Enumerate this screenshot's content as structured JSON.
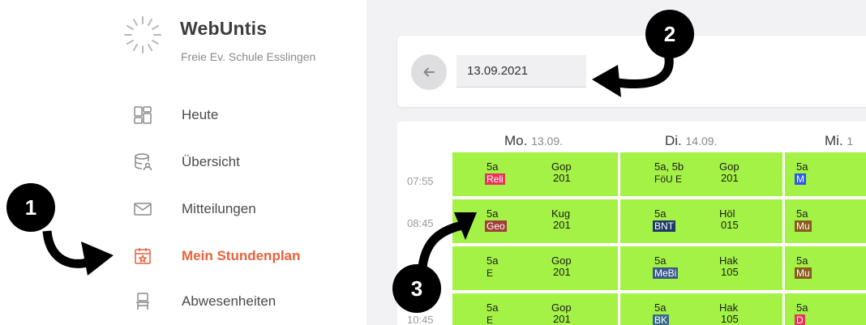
{
  "sidebar": {
    "brand_name": "WebUntis",
    "school": "Freie Ev. Schule Esslingen",
    "items": [
      {
        "label": "Heute",
        "icon": "dashboard-icon",
        "active": false
      },
      {
        "label": "Übersicht",
        "icon": "database-user-icon",
        "active": false
      },
      {
        "label": "Mitteilungen",
        "icon": "mail-icon",
        "active": false
      },
      {
        "label": "Mein Stundenplan",
        "icon": "calendar-star-icon",
        "active": true
      },
      {
        "label": "Abwesenheiten",
        "icon": "chair-icon",
        "active": false
      }
    ],
    "active_color": "#e8623c"
  },
  "date_bar": {
    "date_value": "13.09.2021",
    "back_icon": "arrow-left-icon"
  },
  "timetable": {
    "days": [
      {
        "name": "Mo.",
        "date": "13.09."
      },
      {
        "name": "Di.",
        "date": "14.09."
      },
      {
        "name": "Mi.",
        "date": "1"
      }
    ],
    "times": [
      "07:55",
      "08:45",
      "10:45"
    ],
    "lesson_color": "#a4f246",
    "rows": [
      {
        "mo": [
          {
            "class": "5a",
            "subject": "Reli",
            "subject_color": "#e8345a",
            "teacher": "Gop",
            "room": "201"
          }
        ],
        "di": [
          {
            "class": "5a, 5b",
            "subject": "FöU E",
            "subject_color": "",
            "teacher": "Gop",
            "room": "201"
          }
        ],
        "mi": [
          {
            "class": "5a",
            "subject": "M",
            "subject_color": "#2b5ce8",
            "teacher": "",
            "room": ""
          }
        ]
      },
      {
        "mo": [
          {
            "class": "5a",
            "subject": "Geo",
            "subject_color": "#a0403a",
            "teacher": "Kug",
            "room": "201"
          }
        ],
        "di": [
          {
            "class": "5a",
            "subject": "BNT",
            "subject_color": "#1e3a66",
            "teacher": "Höl",
            "room": "015"
          }
        ],
        "mi": [
          {
            "class": "5a",
            "subject": "Mu",
            "subject_color": "#8a5a1e",
            "teacher": "",
            "room": ""
          }
        ]
      },
      {
        "mo": [
          {
            "class": "5a",
            "subject": "E",
            "subject_color": "",
            "teacher": "Gop",
            "room": "201"
          }
        ],
        "di": [
          {
            "class": "5a",
            "subject": "MeBi",
            "subject_color": "#3a5a8a",
            "teacher": "Hak",
            "room": "105"
          }
        ],
        "mi": [
          {
            "class": "5a",
            "subject": "Mu",
            "subject_color": "#8a5a1e",
            "teacher": "",
            "room": ""
          }
        ]
      },
      {
        "mo": [
          {
            "class": "5a",
            "subject": "E",
            "subject_color": "",
            "teacher": "Gop",
            "room": "201"
          }
        ],
        "di": [
          {
            "class": "5a",
            "subject": "BK",
            "subject_color": "#3a6a8a",
            "teacher": "Hak",
            "room": "105"
          }
        ],
        "mi": [
          {
            "class": "5a",
            "subject": "D",
            "subject_color": "#e8345a",
            "teacher": "",
            "room": ""
          }
        ]
      }
    ]
  },
  "annotations": {
    "marker_1": "1",
    "marker_2": "2",
    "marker_3": "3"
  }
}
